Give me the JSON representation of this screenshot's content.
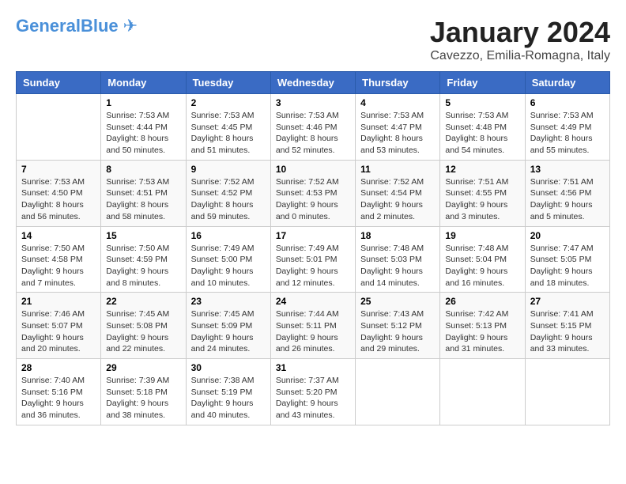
{
  "header": {
    "logo_general": "General",
    "logo_blue": "Blue",
    "month": "January 2024",
    "location": "Cavezzo, Emilia-Romagna, Italy"
  },
  "days_of_week": [
    "Sunday",
    "Monday",
    "Tuesday",
    "Wednesday",
    "Thursday",
    "Friday",
    "Saturday"
  ],
  "weeks": [
    [
      {
        "day": "",
        "sunrise": "",
        "sunset": "",
        "daylight": ""
      },
      {
        "day": "1",
        "sunrise": "Sunrise: 7:53 AM",
        "sunset": "Sunset: 4:44 PM",
        "daylight": "Daylight: 8 hours and 50 minutes."
      },
      {
        "day": "2",
        "sunrise": "Sunrise: 7:53 AM",
        "sunset": "Sunset: 4:45 PM",
        "daylight": "Daylight: 8 hours and 51 minutes."
      },
      {
        "day": "3",
        "sunrise": "Sunrise: 7:53 AM",
        "sunset": "Sunset: 4:46 PM",
        "daylight": "Daylight: 8 hours and 52 minutes."
      },
      {
        "day": "4",
        "sunrise": "Sunrise: 7:53 AM",
        "sunset": "Sunset: 4:47 PM",
        "daylight": "Daylight: 8 hours and 53 minutes."
      },
      {
        "day": "5",
        "sunrise": "Sunrise: 7:53 AM",
        "sunset": "Sunset: 4:48 PM",
        "daylight": "Daylight: 8 hours and 54 minutes."
      },
      {
        "day": "6",
        "sunrise": "Sunrise: 7:53 AM",
        "sunset": "Sunset: 4:49 PM",
        "daylight": "Daylight: 8 hours and 55 minutes."
      }
    ],
    [
      {
        "day": "7",
        "sunrise": "Sunrise: 7:53 AM",
        "sunset": "Sunset: 4:50 PM",
        "daylight": "Daylight: 8 hours and 56 minutes."
      },
      {
        "day": "8",
        "sunrise": "Sunrise: 7:53 AM",
        "sunset": "Sunset: 4:51 PM",
        "daylight": "Daylight: 8 hours and 58 minutes."
      },
      {
        "day": "9",
        "sunrise": "Sunrise: 7:52 AM",
        "sunset": "Sunset: 4:52 PM",
        "daylight": "Daylight: 8 hours and 59 minutes."
      },
      {
        "day": "10",
        "sunrise": "Sunrise: 7:52 AM",
        "sunset": "Sunset: 4:53 PM",
        "daylight": "Daylight: 9 hours and 0 minutes."
      },
      {
        "day": "11",
        "sunrise": "Sunrise: 7:52 AM",
        "sunset": "Sunset: 4:54 PM",
        "daylight": "Daylight: 9 hours and 2 minutes."
      },
      {
        "day": "12",
        "sunrise": "Sunrise: 7:51 AM",
        "sunset": "Sunset: 4:55 PM",
        "daylight": "Daylight: 9 hours and 3 minutes."
      },
      {
        "day": "13",
        "sunrise": "Sunrise: 7:51 AM",
        "sunset": "Sunset: 4:56 PM",
        "daylight": "Daylight: 9 hours and 5 minutes."
      }
    ],
    [
      {
        "day": "14",
        "sunrise": "Sunrise: 7:50 AM",
        "sunset": "Sunset: 4:58 PM",
        "daylight": "Daylight: 9 hours and 7 minutes."
      },
      {
        "day": "15",
        "sunrise": "Sunrise: 7:50 AM",
        "sunset": "Sunset: 4:59 PM",
        "daylight": "Daylight: 9 hours and 8 minutes."
      },
      {
        "day": "16",
        "sunrise": "Sunrise: 7:49 AM",
        "sunset": "Sunset: 5:00 PM",
        "daylight": "Daylight: 9 hours and 10 minutes."
      },
      {
        "day": "17",
        "sunrise": "Sunrise: 7:49 AM",
        "sunset": "Sunset: 5:01 PM",
        "daylight": "Daylight: 9 hours and 12 minutes."
      },
      {
        "day": "18",
        "sunrise": "Sunrise: 7:48 AM",
        "sunset": "Sunset: 5:03 PM",
        "daylight": "Daylight: 9 hours and 14 minutes."
      },
      {
        "day": "19",
        "sunrise": "Sunrise: 7:48 AM",
        "sunset": "Sunset: 5:04 PM",
        "daylight": "Daylight: 9 hours and 16 minutes."
      },
      {
        "day": "20",
        "sunrise": "Sunrise: 7:47 AM",
        "sunset": "Sunset: 5:05 PM",
        "daylight": "Daylight: 9 hours and 18 minutes."
      }
    ],
    [
      {
        "day": "21",
        "sunrise": "Sunrise: 7:46 AM",
        "sunset": "Sunset: 5:07 PM",
        "daylight": "Daylight: 9 hours and 20 minutes."
      },
      {
        "day": "22",
        "sunrise": "Sunrise: 7:45 AM",
        "sunset": "Sunset: 5:08 PM",
        "daylight": "Daylight: 9 hours and 22 minutes."
      },
      {
        "day": "23",
        "sunrise": "Sunrise: 7:45 AM",
        "sunset": "Sunset: 5:09 PM",
        "daylight": "Daylight: 9 hours and 24 minutes."
      },
      {
        "day": "24",
        "sunrise": "Sunrise: 7:44 AM",
        "sunset": "Sunset: 5:11 PM",
        "daylight": "Daylight: 9 hours and 26 minutes."
      },
      {
        "day": "25",
        "sunrise": "Sunrise: 7:43 AM",
        "sunset": "Sunset: 5:12 PM",
        "daylight": "Daylight: 9 hours and 29 minutes."
      },
      {
        "day": "26",
        "sunrise": "Sunrise: 7:42 AM",
        "sunset": "Sunset: 5:13 PM",
        "daylight": "Daylight: 9 hours and 31 minutes."
      },
      {
        "day": "27",
        "sunrise": "Sunrise: 7:41 AM",
        "sunset": "Sunset: 5:15 PM",
        "daylight": "Daylight: 9 hours and 33 minutes."
      }
    ],
    [
      {
        "day": "28",
        "sunrise": "Sunrise: 7:40 AM",
        "sunset": "Sunset: 5:16 PM",
        "daylight": "Daylight: 9 hours and 36 minutes."
      },
      {
        "day": "29",
        "sunrise": "Sunrise: 7:39 AM",
        "sunset": "Sunset: 5:18 PM",
        "daylight": "Daylight: 9 hours and 38 minutes."
      },
      {
        "day": "30",
        "sunrise": "Sunrise: 7:38 AM",
        "sunset": "Sunset: 5:19 PM",
        "daylight": "Daylight: 9 hours and 40 minutes."
      },
      {
        "day": "31",
        "sunrise": "Sunrise: 7:37 AM",
        "sunset": "Sunset: 5:20 PM",
        "daylight": "Daylight: 9 hours and 43 minutes."
      },
      {
        "day": "",
        "sunrise": "",
        "sunset": "",
        "daylight": ""
      },
      {
        "day": "",
        "sunrise": "",
        "sunset": "",
        "daylight": ""
      },
      {
        "day": "",
        "sunrise": "",
        "sunset": "",
        "daylight": ""
      }
    ]
  ]
}
